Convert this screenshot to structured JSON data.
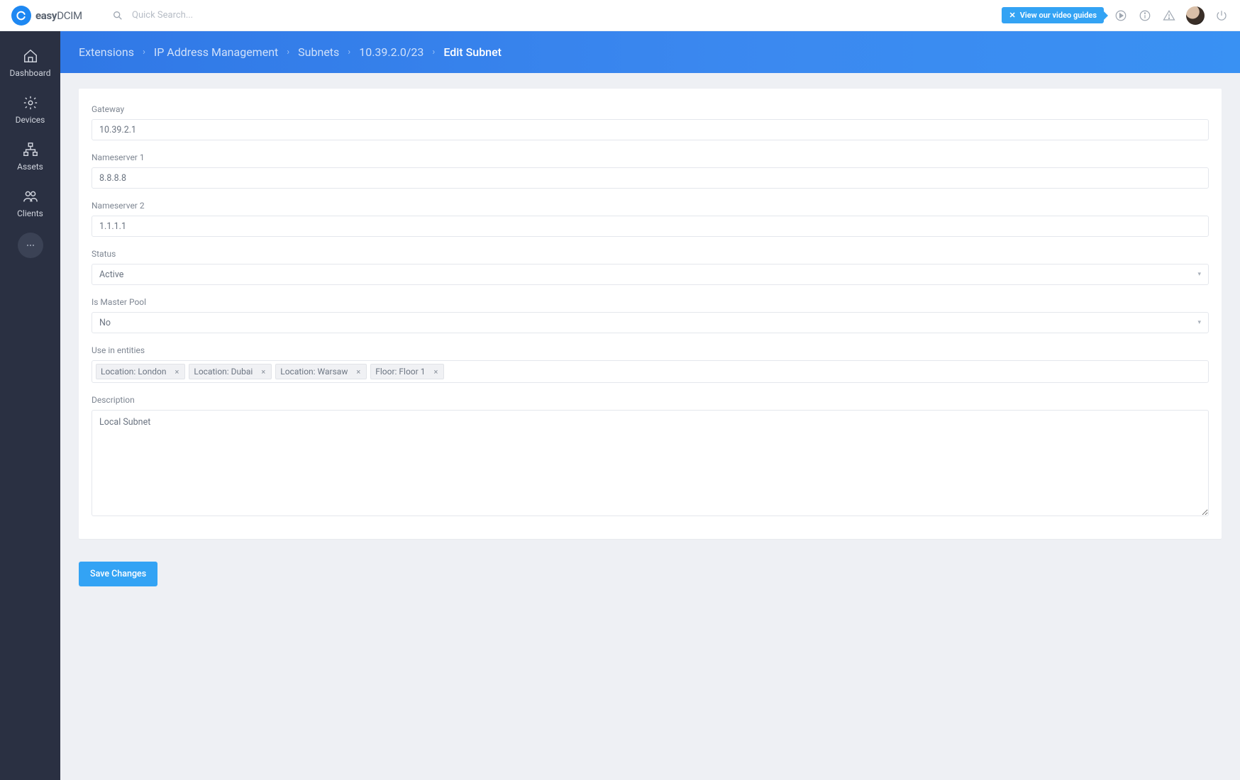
{
  "topbar": {
    "logo_text_bold": "easy",
    "logo_text_thin": "DCIM",
    "search_placeholder": "Quick Search...",
    "video_guide_label": "View our video guides"
  },
  "sidebar": {
    "items": [
      {
        "label": "Dashboard",
        "icon": "home-icon"
      },
      {
        "label": "Devices",
        "icon": "gear-icon"
      },
      {
        "label": "Assets",
        "icon": "network-icon"
      },
      {
        "label": "Clients",
        "icon": "users-icon"
      }
    ]
  },
  "breadcrumb": {
    "items": [
      "Extensions",
      "IP Address Management",
      "Subnets",
      "10.39.2.0/23",
      "Edit Subnet"
    ]
  },
  "form": {
    "gateway": {
      "label": "Gateway",
      "value": "10.39.2.1"
    },
    "ns1": {
      "label": "Nameserver 1",
      "value": "8.8.8.8"
    },
    "ns2": {
      "label": "Nameserver 2",
      "value": "1.1.1.1"
    },
    "status": {
      "label": "Status",
      "value": "Active"
    },
    "master_pool": {
      "label": "Is Master Pool",
      "value": "No"
    },
    "use_in_entities": {
      "label": "Use in entities",
      "tags": [
        "Location: London",
        "Location: Dubai",
        "Location: Warsaw",
        "Floor: Floor 1"
      ]
    },
    "description": {
      "label": "Description",
      "value": "Local Subnet"
    },
    "save_label": "Save Changes"
  }
}
